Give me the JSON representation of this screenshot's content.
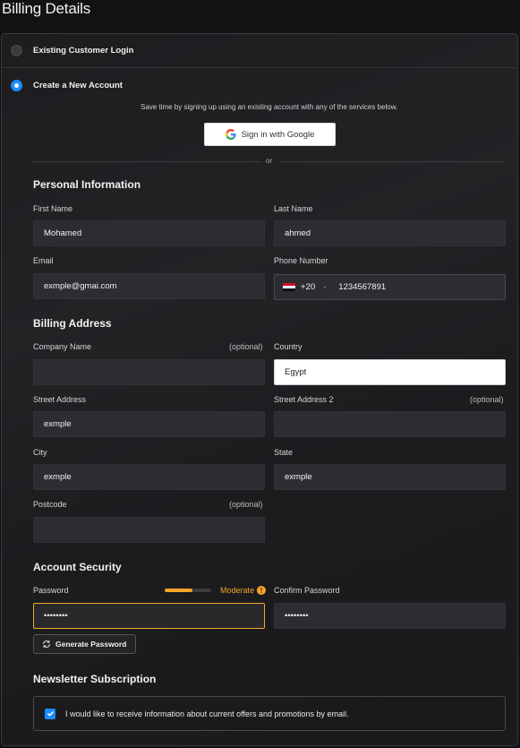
{
  "page_title": "Billing Details",
  "account_options": {
    "existing_label": "Existing Customer Login",
    "existing_selected": false,
    "new_label": "Create a New Account",
    "new_selected": true
  },
  "social": {
    "hint": "Save time by signing up using an existing account with any of the services below.",
    "google_label": "Sign in with Google",
    "or_text": "or"
  },
  "personal": {
    "heading": "Personal Information",
    "first_name": {
      "label": "First Name",
      "value": "Mohamed"
    },
    "last_name": {
      "label": "Last Name",
      "value": "ahmed"
    },
    "email": {
      "label": "Email",
      "value": "exmple@gmai.com"
    },
    "phone": {
      "label": "Phone Number",
      "country_code": "+20",
      "separator": "-",
      "value": "1234567891",
      "flag_icon": "egypt-flag-icon"
    }
  },
  "billing": {
    "heading": "Billing Address",
    "optional_tag": "(optional)",
    "company": {
      "label": "Company Name",
      "value": ""
    },
    "country": {
      "label": "Country",
      "value": "Egypt"
    },
    "street1": {
      "label": "Street Address",
      "value": "exmple"
    },
    "street2": {
      "label": "Street Address 2",
      "value": ""
    },
    "city": {
      "label": "City",
      "value": "exmple"
    },
    "state": {
      "label": "State",
      "value": "exmple"
    },
    "postcode": {
      "label": "Postcode",
      "value": ""
    }
  },
  "security": {
    "heading": "Account Security",
    "password_label": "Password",
    "password_value": "••••••••",
    "strength_label": "Moderate",
    "strength_level": 0.6,
    "confirm_label": "Confirm Password",
    "confirm_value": "••••••••",
    "generate_label": "Generate Password"
  },
  "newsletter": {
    "heading": "Newsletter Subscription",
    "checkbox_label": "I would like to receive information about current offers and promotions by email.",
    "checked": true
  },
  "colors": {
    "accent": "#1a8cff",
    "warning": "#f5a623",
    "background": "#121214",
    "panel": "#1f1f22"
  }
}
